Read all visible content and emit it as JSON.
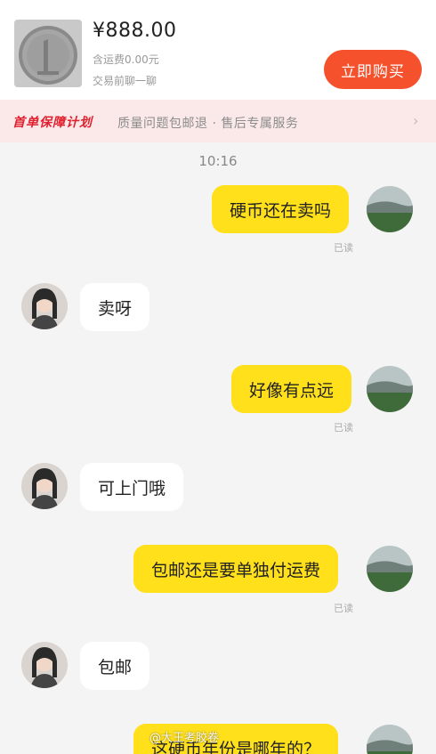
{
  "product": {
    "price": "¥888.00",
    "shipping_note": "含运费0.00元",
    "pre_trade_note": "交易前聊一聊",
    "buy_button": "立即购买"
  },
  "banner": {
    "title": "首单保障计划",
    "text": "质量问题包邮退 · 售后专属服务",
    "arrow": "›"
  },
  "timestamp": "10:16",
  "messages": [
    {
      "from": "me",
      "text": "硬币还在卖吗",
      "status": "已读"
    },
    {
      "from": "them",
      "text": "卖呀"
    },
    {
      "from": "me",
      "text": "好像有点远",
      "status": "已读"
    },
    {
      "from": "them",
      "text": "可上门哦"
    },
    {
      "from": "me",
      "text": "包邮还是要单独付运费",
      "status": "已读"
    },
    {
      "from": "them",
      "text": "包邮"
    },
    {
      "from": "me",
      "text": "这硬币年份是哪年的？"
    }
  ],
  "watermark": "@大王考胶卷"
}
